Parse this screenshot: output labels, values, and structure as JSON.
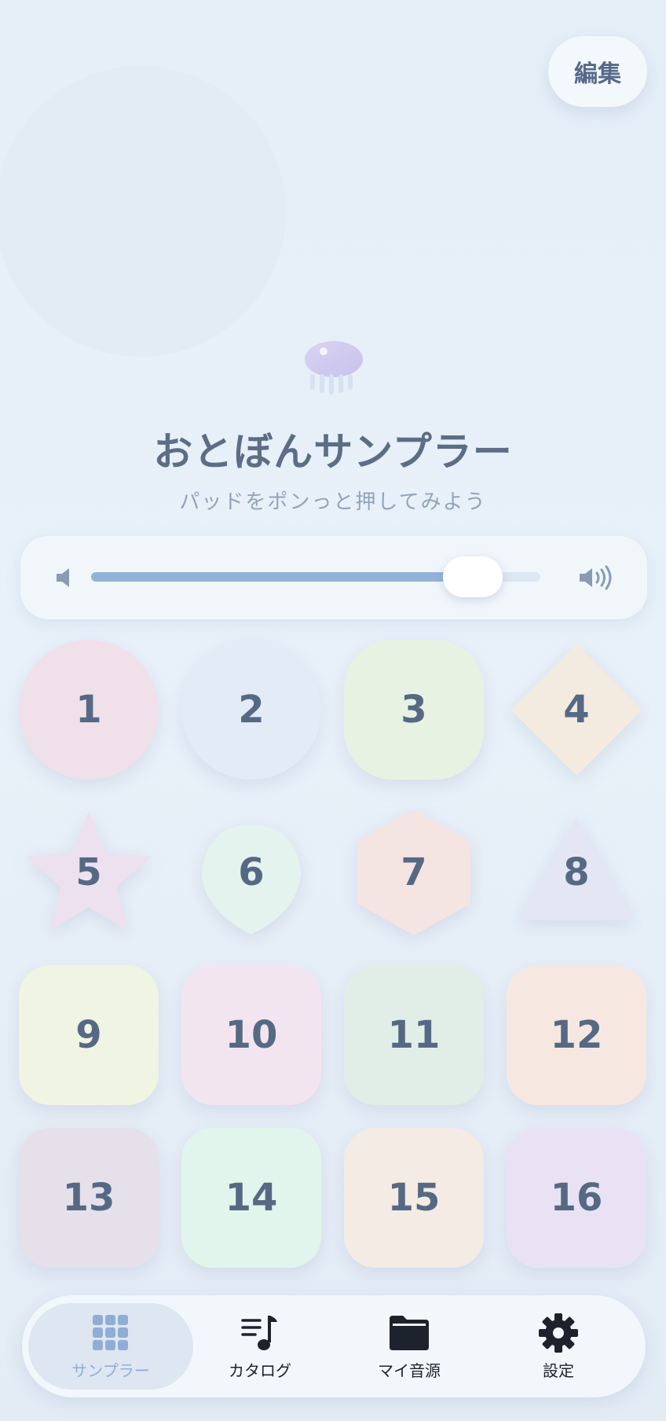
{
  "header": {
    "edit_label": "編集"
  },
  "app": {
    "title": "おとぼんサンプラー",
    "subtitle": "パッドをポンっと押してみよう"
  },
  "volume": {
    "level": 0.85
  },
  "pads": [
    {
      "label": "1",
      "shape": "circle",
      "color": "#f0e0e9"
    },
    {
      "label": "2",
      "shape": "circle",
      "color": "#e2ebf6"
    },
    {
      "label": "3",
      "shape": "squircle",
      "color": "#e8f2e2"
    },
    {
      "label": "4",
      "shape": "diamond",
      "color": "#f3ebe0"
    },
    {
      "label": "5",
      "shape": "star",
      "color": "#ede1f0"
    },
    {
      "label": "6",
      "shape": "drop",
      "color": "#e4f3ee"
    },
    {
      "label": "7",
      "shape": "hexagon",
      "color": "#f4e4e2"
    },
    {
      "label": "8",
      "shape": "triangle",
      "color": "#e5e6f4"
    },
    {
      "label": "9",
      "shape": "rounded",
      "color": "#f0f4e2"
    },
    {
      "label": "10",
      "shape": "rounded",
      "color": "#f3e5f0"
    },
    {
      "label": "11",
      "shape": "rounded",
      "color": "#e1ede7"
    },
    {
      "label": "12",
      "shape": "rounded",
      "color": "#f6e8e1"
    },
    {
      "label": "13",
      "shape": "rounded",
      "color": "#e6e0eb"
    },
    {
      "label": "14",
      "shape": "rounded",
      "color": "#e2f5ec"
    },
    {
      "label": "15",
      "shape": "rounded",
      "color": "#f3ebe4"
    },
    {
      "label": "16",
      "shape": "rounded",
      "color": "#e8e2f4"
    }
  ],
  "tabs": [
    {
      "label": "サンプラー",
      "icon": "grid-icon",
      "active": true
    },
    {
      "label": "カタログ",
      "icon": "music-list-icon",
      "active": false
    },
    {
      "label": "マイ音源",
      "icon": "folder-icon",
      "active": false
    },
    {
      "label": "設定",
      "icon": "gear-icon",
      "active": false
    }
  ],
  "colors": {
    "accent": "#8faed6",
    "text": "#566984",
    "background": "#e6eff8"
  }
}
